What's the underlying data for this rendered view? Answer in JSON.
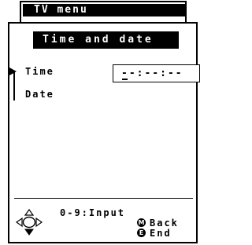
{
  "background_window": {
    "title": "TV menu"
  },
  "dialog": {
    "title": "Time and date",
    "menu": {
      "items": [
        {
          "label": "Time",
          "selected": true
        },
        {
          "label": "Date",
          "selected": false
        }
      ]
    },
    "time_field": {
      "value": "--:--:--"
    },
    "footer": {
      "dpad_icon": "dpad-icon",
      "input_hint": "0-9:Input",
      "back_button_glyph": "M",
      "back_label": "Back",
      "end_button_glyph": "E",
      "end_label": "End"
    }
  }
}
